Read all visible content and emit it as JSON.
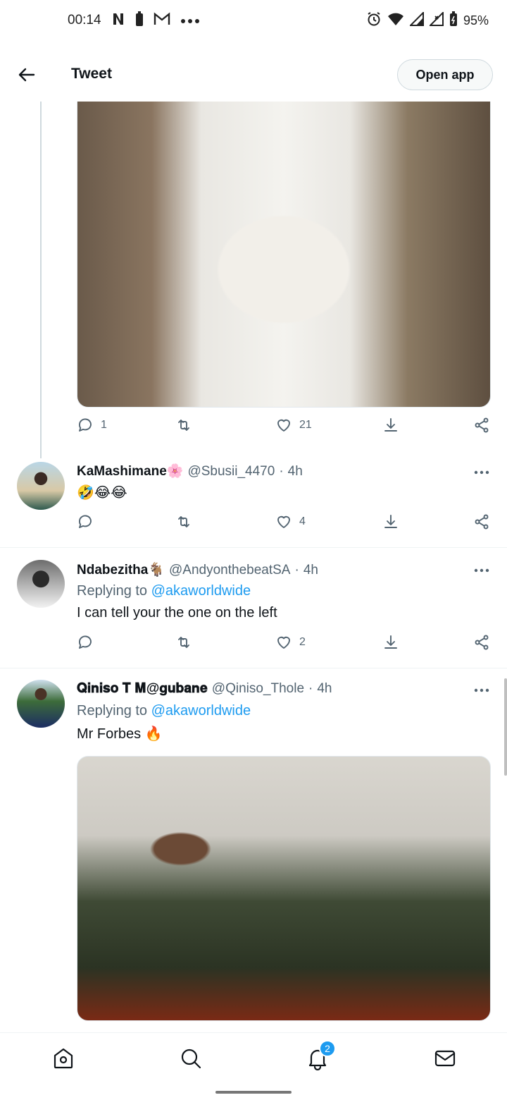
{
  "status_bar": {
    "time": "00:14",
    "battery_percent": "95%",
    "left_icons": [
      "netflix-n-icon",
      "battery-saver-icon",
      "gmail-icon",
      "more-dots-icon"
    ],
    "right_icons": [
      "alarm-icon",
      "wifi-icon",
      "signal-icon",
      "signal-x-icon",
      "battery-icon"
    ]
  },
  "header": {
    "title": "Tweet",
    "open_app_label": "Open app"
  },
  "main_tweet": {
    "reply_count": "1",
    "retweet_count": "",
    "like_count": "21"
  },
  "replies": [
    {
      "name": "KaMashimane🌸",
      "handle": "@Sbusii_4470",
      "time": "4h",
      "replying_to_prefix": "",
      "replying_to": "",
      "text": "🤣😂😂",
      "reply_count": "",
      "retweet_count": "",
      "like_count": "4"
    },
    {
      "name": "Ndabezitha🐐",
      "handle": "@AndyonthebeatSA",
      "time": "4h",
      "replying_to_prefix": "Replying to",
      "replying_to": "@akaworldwide",
      "text": "I can tell your the one on the left",
      "reply_count": "",
      "retweet_count": "",
      "like_count": "2"
    },
    {
      "name": "𝐐𝐢𝐧𝐢𝐬𝐨 𝐓 𝐌@𝐠𝐮𝐛𝐚𝐧𝐞",
      "handle": "@Qiniso_Thole",
      "time": "4h",
      "replying_to_prefix": "Replying to",
      "replying_to": "@akaworldwide",
      "text": "Mr Forbes 🔥"
    }
  ],
  "separator": "·",
  "bottom_nav": {
    "items": [
      "home-icon",
      "search-icon",
      "notifications-icon",
      "messages-icon"
    ],
    "notification_badge": "2"
  },
  "colors": {
    "accent": "#1d9bf0",
    "text_primary": "#0f1419",
    "text_secondary": "#536471",
    "divider": "#eff3f4"
  }
}
